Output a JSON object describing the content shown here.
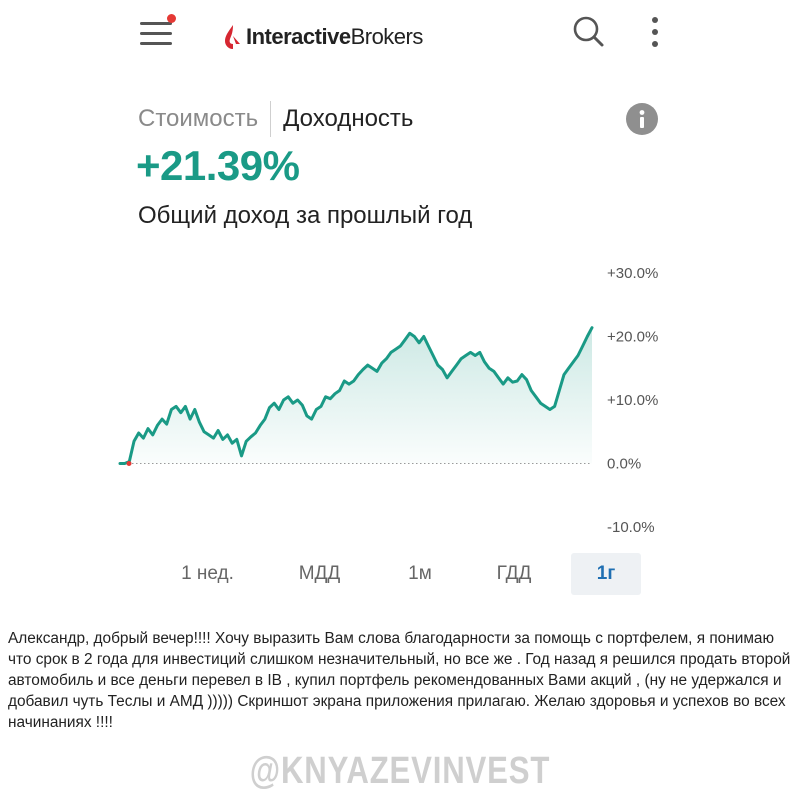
{
  "header": {
    "brand_bold": "Interactive",
    "brand_light": "Brokers",
    "menu_icon": "hamburger-menu-icon",
    "search_icon": "search-icon",
    "more_icon": "more-vertical-icon",
    "notification_color": "#e53935"
  },
  "tabs": [
    {
      "label": "Стоимость",
      "active": false
    },
    {
      "label": "Доходность",
      "active": true
    }
  ],
  "info_icon": "info-icon",
  "summary": {
    "value": "+21.39%",
    "caption": "Общий доход за прошлый год",
    "accent_color": "#1a9a86"
  },
  "ranges": [
    {
      "label": "1 нед.",
      "selected": false
    },
    {
      "label": "МДД",
      "selected": false
    },
    {
      "label": "1м",
      "selected": false
    },
    {
      "label": "ГДД",
      "selected": false
    },
    {
      "label": "1г",
      "selected": true
    }
  ],
  "chart_data": {
    "type": "area",
    "y_tick_labels": [
      "+30.0%",
      "+20.0%",
      "+10.0%",
      "0.0%",
      "-10.0%"
    ],
    "y_ticks": [
      30,
      20,
      10,
      0,
      -10
    ],
    "ylim": [
      -10,
      30
    ],
    "baseline": 0,
    "grid": false,
    "line_color": "#1a9a86",
    "series": [
      {
        "values": [
          0.0,
          0.0,
          0.3,
          3.5,
          4.8,
          4.0,
          5.5,
          4.5,
          6.0,
          7.0,
          6.2,
          8.5,
          9.0,
          8.0,
          9.0,
          7.0,
          8.5,
          6.5,
          5.0,
          4.5,
          4.0,
          5.2,
          3.8,
          4.5,
          3.2,
          3.8,
          1.2,
          3.5,
          4.2,
          4.8,
          6.0,
          7.0,
          8.8,
          9.5,
          8.5,
          10.0,
          10.5,
          9.5,
          10.0,
          9.2,
          7.5,
          7.0,
          8.5,
          9.0,
          10.5,
          10.2,
          11.0,
          11.5,
          13.0,
          12.5,
          13.0,
          14.0,
          14.8,
          15.5,
          15.0,
          14.5,
          15.8,
          16.5,
          17.5,
          18.0,
          18.5,
          19.5,
          20.5,
          20.0,
          19.0,
          20.0,
          18.5,
          17.0,
          15.5,
          14.8,
          13.5,
          14.5,
          15.5,
          16.5,
          17.0,
          17.5,
          17.0,
          17.5,
          16.0,
          15.0,
          14.5,
          13.5,
          12.5,
          13.5,
          12.8,
          13.0,
          14.0,
          13.2,
          11.5,
          10.5,
          9.5,
          9.0,
          8.5,
          9.0,
          11.5,
          14.0,
          15.0,
          16.0,
          17.0,
          18.5,
          20.0,
          21.39
        ]
      }
    ]
  },
  "message": "Александр, добрый вечер!!!! Хочу выразить Вам слова благодарности за помощь с портфелем, я понимаю что срок в 2 года для инвестиций слишком незначительный, но все же . Год назад я решился продать второй автомобиль и все деньги перевел в IB , купил портфель рекомендованных Вами акций , (ну не удержался и добавил чуть Теслы и АМД ))))) Скриншот экрана приложения прилагаю. Желаю здоровья и успехов во всех начинаниях !!!!",
  "watermark": "@KNYAZEVINVEST"
}
